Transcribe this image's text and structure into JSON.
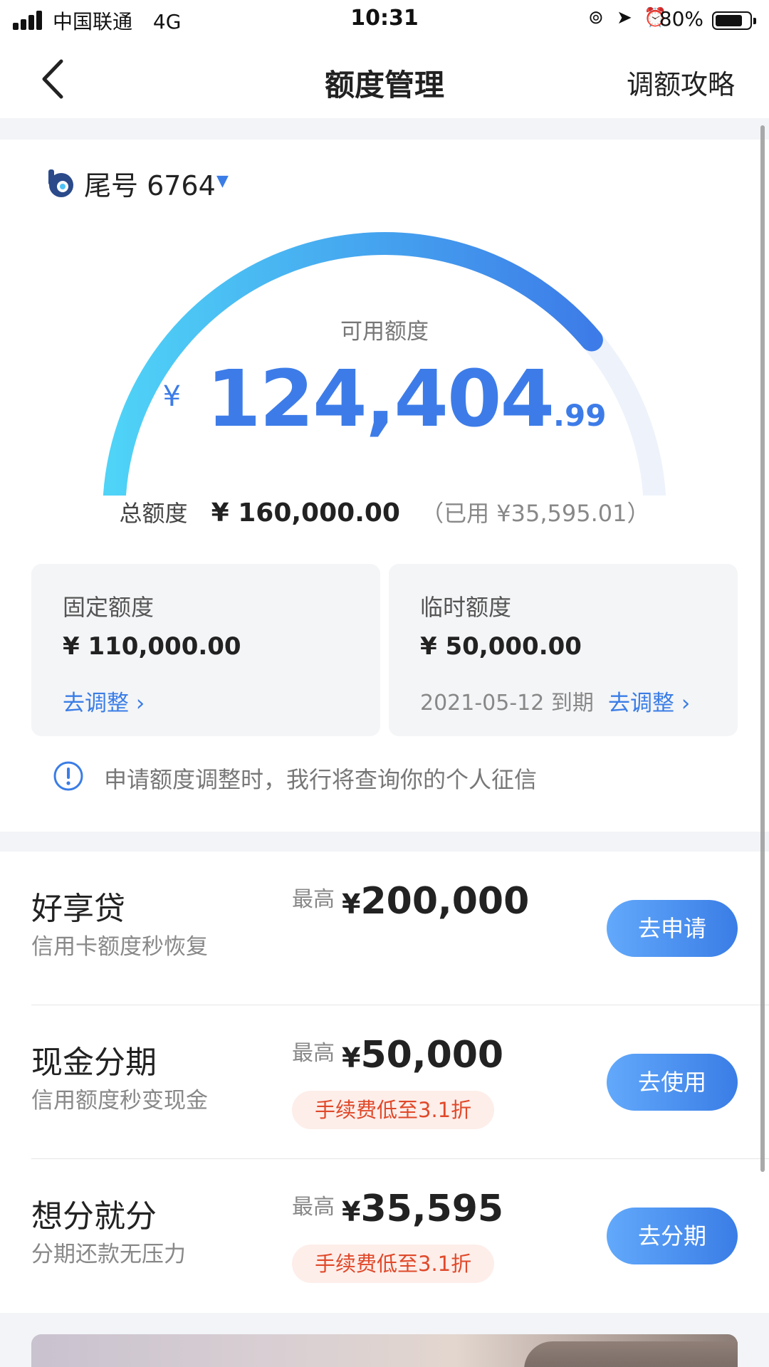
{
  "status_bar": {
    "carrier": "中国联通",
    "network": "4G",
    "time": "10:31",
    "battery": "80%",
    "battery_level": 0.8
  },
  "nav": {
    "title": "额度管理",
    "right_action": "调额攻略"
  },
  "card": {
    "label": "尾号 6764"
  },
  "gauge": {
    "available_fraction": 0.7775,
    "colors": {
      "start": "#4fd3f7",
      "end": "#3d7ce8",
      "track": "#eef3fb"
    }
  },
  "available": {
    "label": "可用额度",
    "currency": "¥",
    "integer": "124,404",
    "decimal": ".99"
  },
  "total": {
    "label": "总额度",
    "amount": "¥ 160,000.00",
    "used": "（已用 ¥35,595.01）"
  },
  "fixed_limit": {
    "title": "固定额度",
    "amount": "¥ 110,000.00",
    "link": "去调整 ›"
  },
  "temp_limit": {
    "title": "临时额度",
    "amount": "¥ 50,000.00",
    "expire": "2021-05-12 到期",
    "link": "去调整 ›"
  },
  "notice": {
    "text": "申请额度调整时，我行将查询你的个人征信"
  },
  "offers": [
    {
      "name": "好享贷",
      "desc": "信用卡额度秒恢复",
      "max_prefix": "最高",
      "currency": "¥",
      "amount": "200,000",
      "tag": "",
      "button": "去申请"
    },
    {
      "name": "现金分期",
      "desc": "信用额度秒变现金",
      "max_prefix": "最高",
      "currency": "¥",
      "amount": "50,000",
      "tag": "手续费低至3.1折",
      "button": "去使用"
    },
    {
      "name": "想分就分",
      "desc": "分期还款无压力",
      "max_prefix": "最高",
      "currency": "¥",
      "amount": "35,595",
      "tag": "手续费低至3.1折",
      "button": "去分期"
    }
  ],
  "colors": {
    "accent": "#3a7de6",
    "tag_text": "#e0492a",
    "tag_bg": "#fdeeea"
  }
}
